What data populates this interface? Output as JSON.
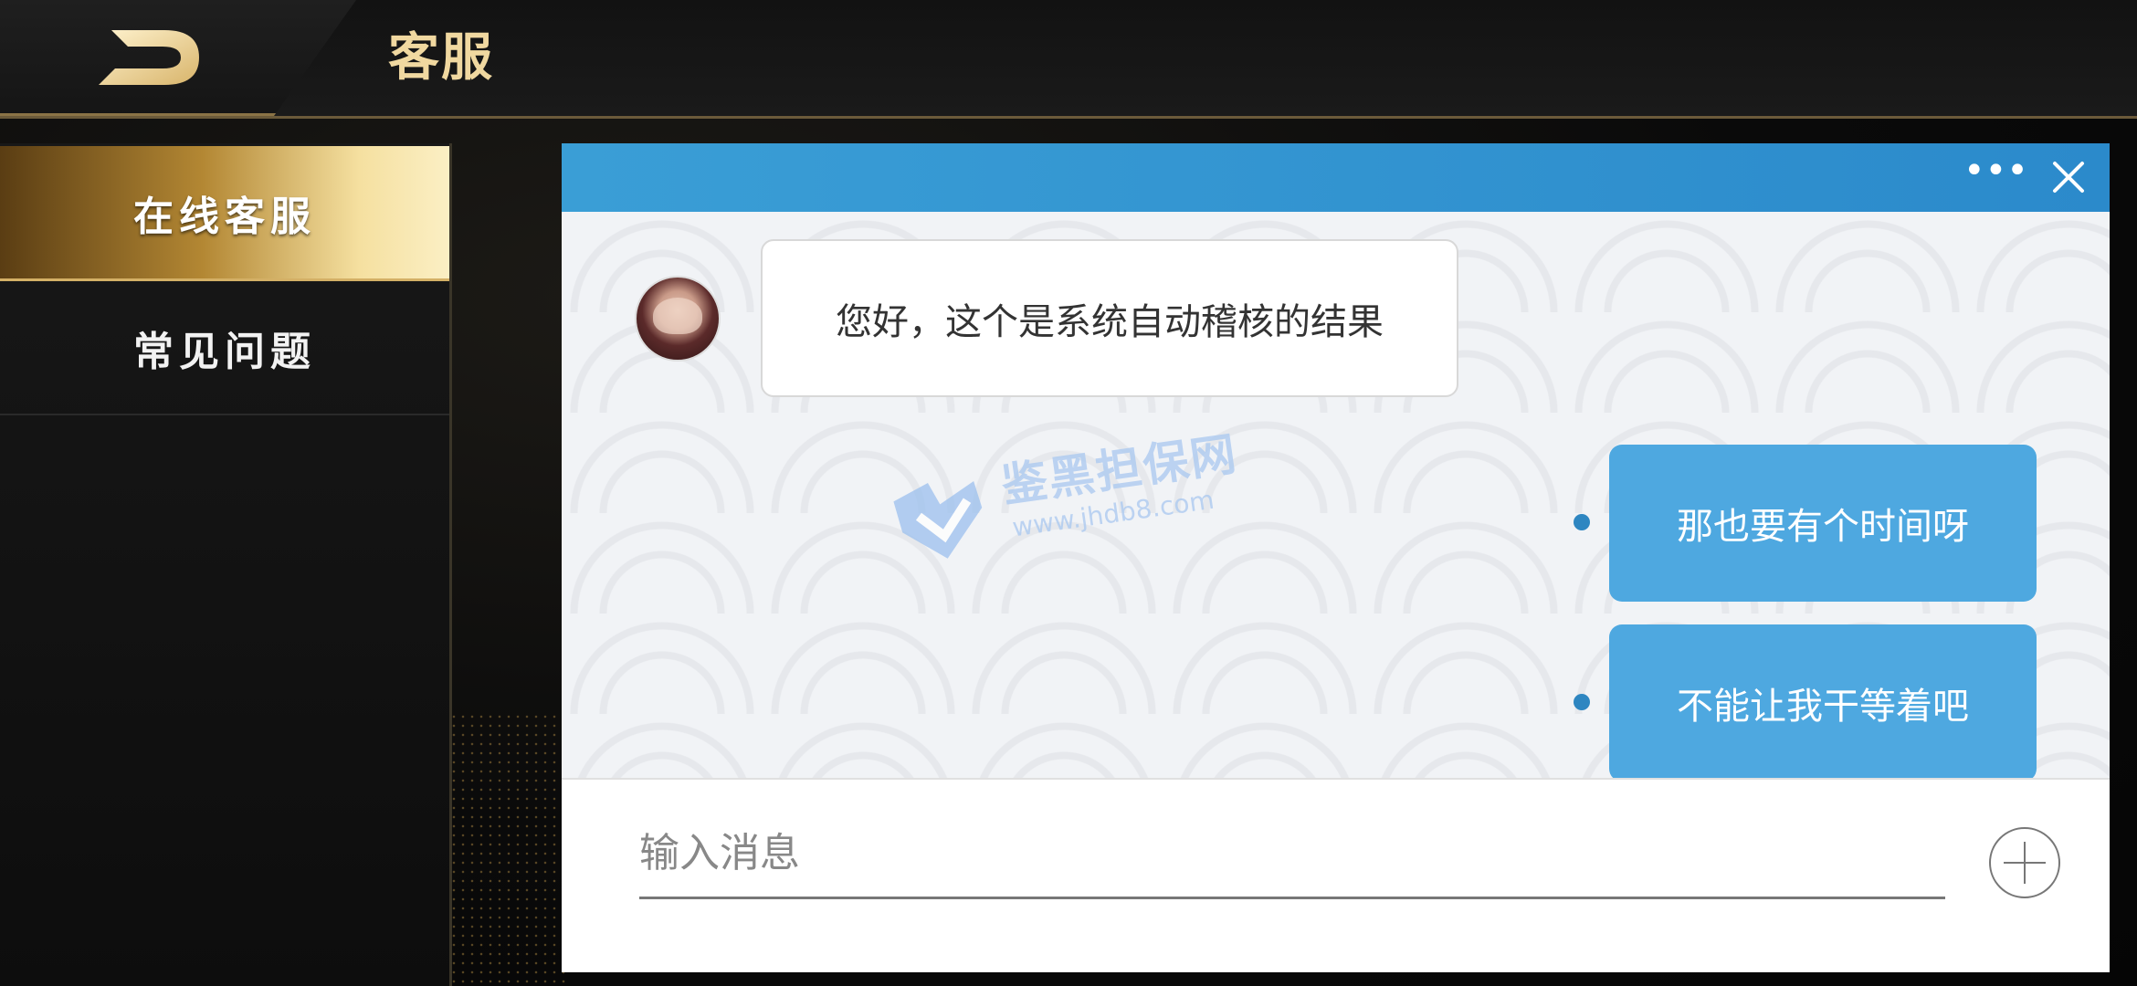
{
  "header": {
    "title": "客服",
    "back_icon": "back-arrow-icon"
  },
  "sidebar": {
    "items": [
      {
        "label": "在线客服",
        "active": true
      },
      {
        "label": "常见问题",
        "active": false
      }
    ]
  },
  "chat": {
    "header": {
      "more_icon": "ellipsis-icon",
      "more_label": "•••",
      "close_icon": "close-icon"
    },
    "messages": [
      {
        "from": "agent",
        "text": "您好，这个是系统自动稽核的结果"
      },
      {
        "from": "user",
        "text": "那也要有个时间呀"
      },
      {
        "from": "user",
        "text": "不能让我干等着吧"
      }
    ],
    "watermark": {
      "title": "鉴黑担保网",
      "url": "www.jhdb8.com"
    },
    "input": {
      "placeholder": "输入消息",
      "value": ""
    },
    "plus_icon": "plus-circle-icon"
  },
  "colors": {
    "accent_gold": "#f0d8a0",
    "chat_header_blue": "#3a9ed6",
    "user_bubble": "#4ea8e0",
    "status_dot": "#2e86c1"
  }
}
